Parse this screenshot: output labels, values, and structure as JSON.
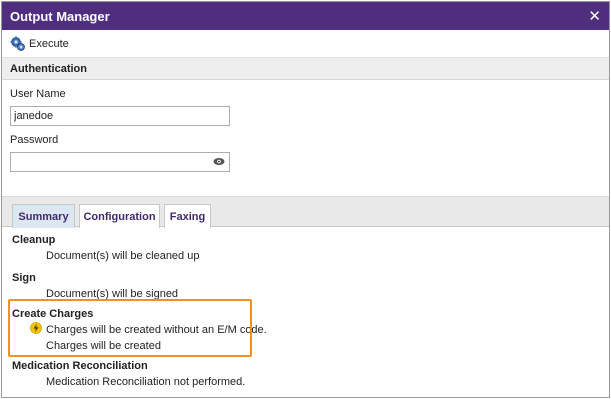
{
  "dialog": {
    "title": "Output Manager",
    "close_glyph": "✕"
  },
  "toolbar": {
    "execute_label": "Execute",
    "execute_icon": "execute-icon"
  },
  "authentication": {
    "header": "Authentication",
    "username_label": "User Name",
    "username_value": "janedoe",
    "password_label": "Password",
    "password_value": "",
    "password_icon": "eye-icon"
  },
  "tabs": [
    {
      "label": "Summary",
      "active": true
    },
    {
      "label": "Configuration",
      "active": false
    },
    {
      "label": "Faxing",
      "active": false
    }
  ],
  "summary": {
    "cleanup": {
      "title": "Cleanup",
      "lines": [
        "Document(s) will be cleaned up"
      ]
    },
    "sign": {
      "title": "Sign",
      "lines": [
        "Document(s) will be signed"
      ]
    },
    "create_charges": {
      "title": "Create Charges",
      "warning": "Charges will be created without an E/M code.",
      "lines": [
        "Charges will be created"
      ],
      "warning_icon": "lightning-icon",
      "highlight_color": "#f0931e"
    },
    "med_rec": {
      "title": "Medication Reconciliation",
      "lines": [
        "Medication Reconciliation not performed."
      ]
    }
  },
  "colors": {
    "titlebar": "#4f2d7f",
    "tab_text": "#3f2a6f",
    "active_tab": "#dde7f1"
  }
}
